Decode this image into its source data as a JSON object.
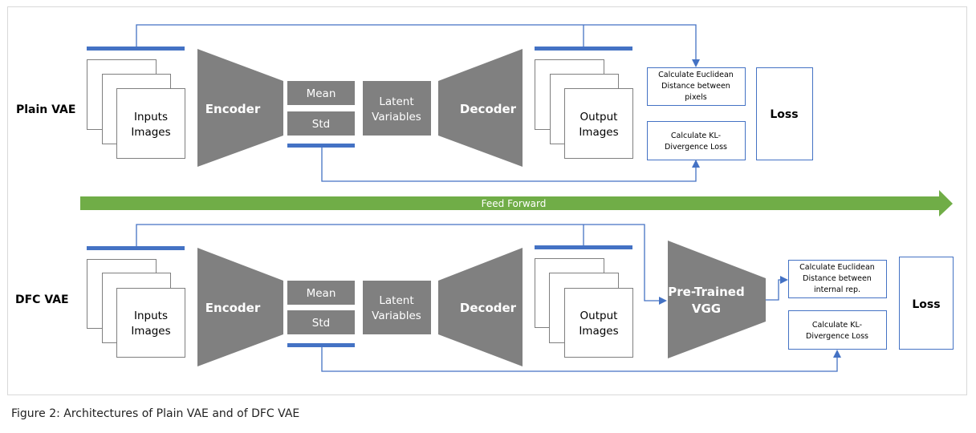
{
  "colors": {
    "block_gray": "#808080",
    "accent_blue": "#4472c4",
    "arrow_green": "#70ad47",
    "frame_gray": "#d9d9d9",
    "box_border": "#7f7f7f",
    "text_dark": "#000000",
    "text_light": "#ffffff"
  },
  "rows": [
    {
      "label": "Plain VAE",
      "inputs_label": [
        "Inputs",
        "Images"
      ],
      "encoder_label": "Encoder",
      "mean_label": "Mean",
      "std_label": "Std",
      "latent_label": [
        "Latent",
        "Variables"
      ],
      "decoder_label": "Decoder",
      "outputs_label": [
        "Output",
        "Images"
      ],
      "euclid_label": [
        "Calculate Euclidean",
        "Distance between",
        "pixels"
      ],
      "kl_label": [
        "Calculate KL-",
        "Divergence Loss"
      ],
      "loss_label": "Loss"
    },
    {
      "label": "DFC VAE",
      "inputs_label": [
        "Inputs",
        "Images"
      ],
      "encoder_label": "Encoder",
      "mean_label": "Mean",
      "std_label": "Std",
      "latent_label": [
        "Latent",
        "Variables"
      ],
      "decoder_label": "Decoder",
      "outputs_label": [
        "Output",
        "Images"
      ],
      "vgg_label": [
        "Pre-Trained",
        "VGG"
      ],
      "euclid_label": [
        "Calculate Euclidean",
        "Distance between",
        "internal rep."
      ],
      "kl_label": [
        "Calculate KL-",
        "Divergence Loss"
      ],
      "loss_label": "Loss"
    }
  ],
  "feed_forward_label": "Feed Forward",
  "caption": "Figure 2: Architectures of Plain VAE and of DFC VAE"
}
